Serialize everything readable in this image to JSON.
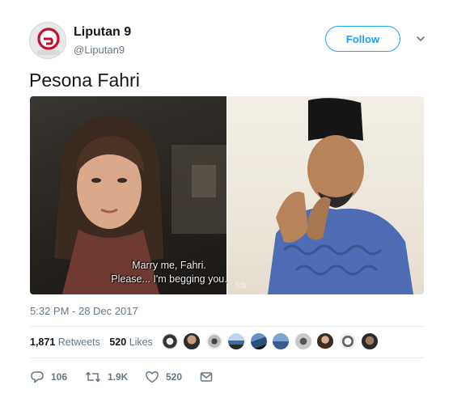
{
  "user": {
    "name": "Liputan 9",
    "handle": "@Liputan9"
  },
  "follow_label": "Follow",
  "tweet": {
    "text": "Pesona Fahri",
    "subtitle_line1": "Marry me, Fahri.",
    "subtitle_line2": "Please... I'm begging you.",
    "watermark": "fcb",
    "timestamp": "5:32 PM - 28 Dec 2017"
  },
  "stats": {
    "retweets_count": "1,871",
    "retweets_label": "Retweets",
    "likes_count": "520",
    "likes_label": "Likes"
  },
  "actions": {
    "replies": "106",
    "retweets": "1.9K",
    "likes": "520"
  },
  "colors": {
    "accent": "#1da1f2",
    "text_secondary": "#657786",
    "brand_logo": "#c8102e"
  },
  "icons": [
    "chevron-down-icon",
    "reply-icon",
    "retweet-icon",
    "like-icon",
    "direct-message-icon"
  ]
}
